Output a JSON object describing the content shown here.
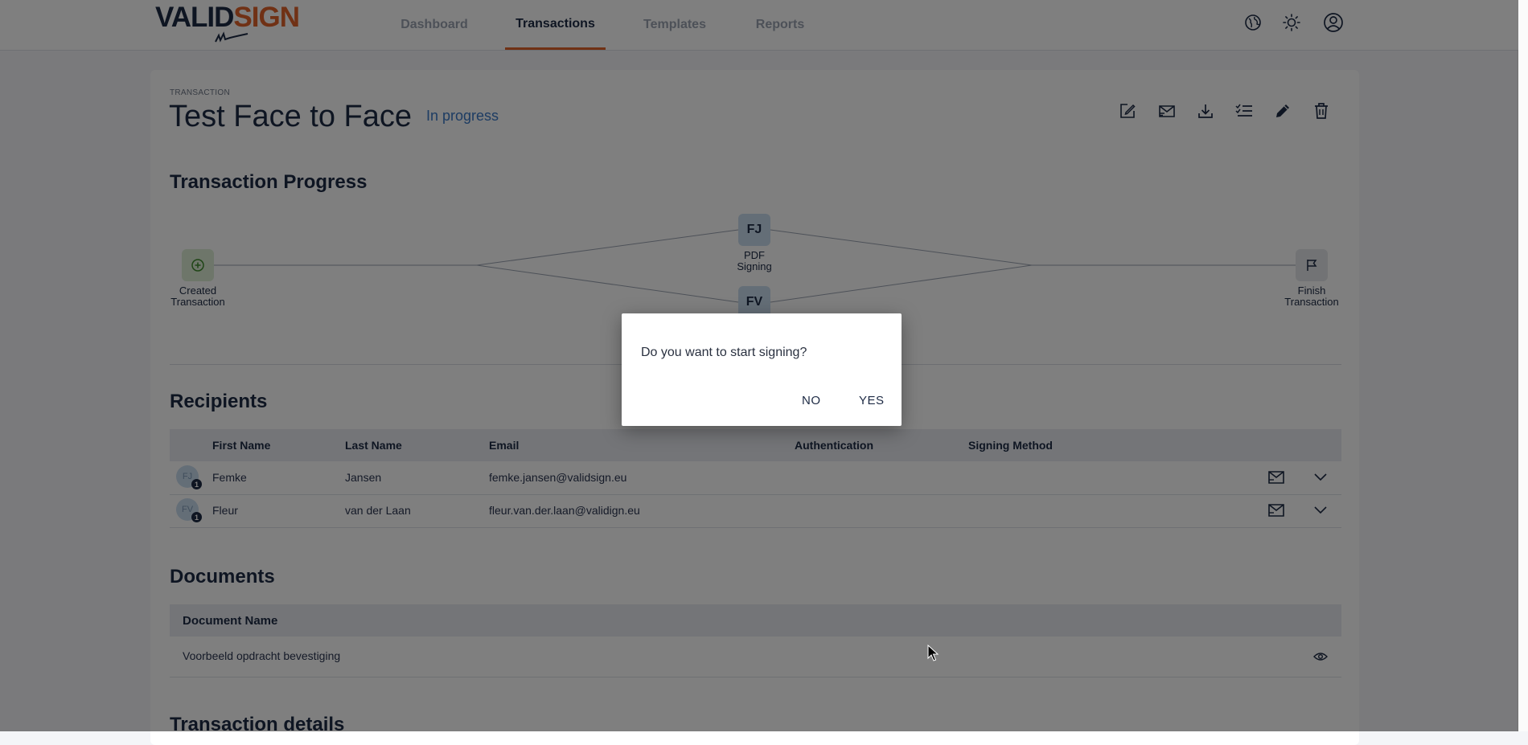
{
  "app": {
    "logo_valid": "VALID",
    "logo_sign": "SIGN",
    "nav": [
      "Dashboard",
      "Transactions",
      "Templates",
      "Reports"
    ],
    "active_nav": "Transactions",
    "header_icons": [
      "globe-icon",
      "sun-icon",
      "account-icon"
    ]
  },
  "transaction": {
    "eyebrow": "TRANSACTION",
    "title": "Test Face to Face",
    "status": "In progress",
    "toolbar_icons": [
      "edit-note-icon",
      "send-reminder-icon",
      "download-icon",
      "checklist-icon",
      "pencil-icon",
      "trash-icon"
    ]
  },
  "progress": {
    "title": "Transaction Progress",
    "start_label_1": "Created",
    "start_label_2": "Transaction",
    "signer1_initials": "FJ",
    "signer1_label_1": "PDF",
    "signer1_label_2": "Signing",
    "signer2_initials": "FV",
    "finish_label_1": "Finish",
    "finish_label_2": "Transaction"
  },
  "recipients": {
    "title": "Recipients",
    "columns": [
      "First Name",
      "Last Name",
      "Email",
      "Authentication",
      "Signing Method"
    ],
    "rows": [
      {
        "initials": "FJ",
        "order": "1",
        "first": "Femke",
        "last": "Jansen",
        "email": "femke.jansen@validsign.eu",
        "auth": "",
        "method": ""
      },
      {
        "initials": "FV",
        "order": "1",
        "first": "Fleur",
        "last": "van der Laan",
        "email": "fleur.van.der.laan@validign.eu",
        "auth": "",
        "method": ""
      }
    ]
  },
  "documents": {
    "title": "Documents",
    "column": "Document Name",
    "rows": [
      {
        "name": "Voorbeeld opdracht bevestiging"
      }
    ]
  },
  "details": {
    "title": "Transaction details"
  },
  "dialog": {
    "message": "Do you want to start signing?",
    "no": "NO",
    "yes": "YES"
  },
  "colors": {
    "brand_navy": "#1d2a44",
    "brand_orange": "#e0622a",
    "status_blue": "#3a78c7"
  }
}
